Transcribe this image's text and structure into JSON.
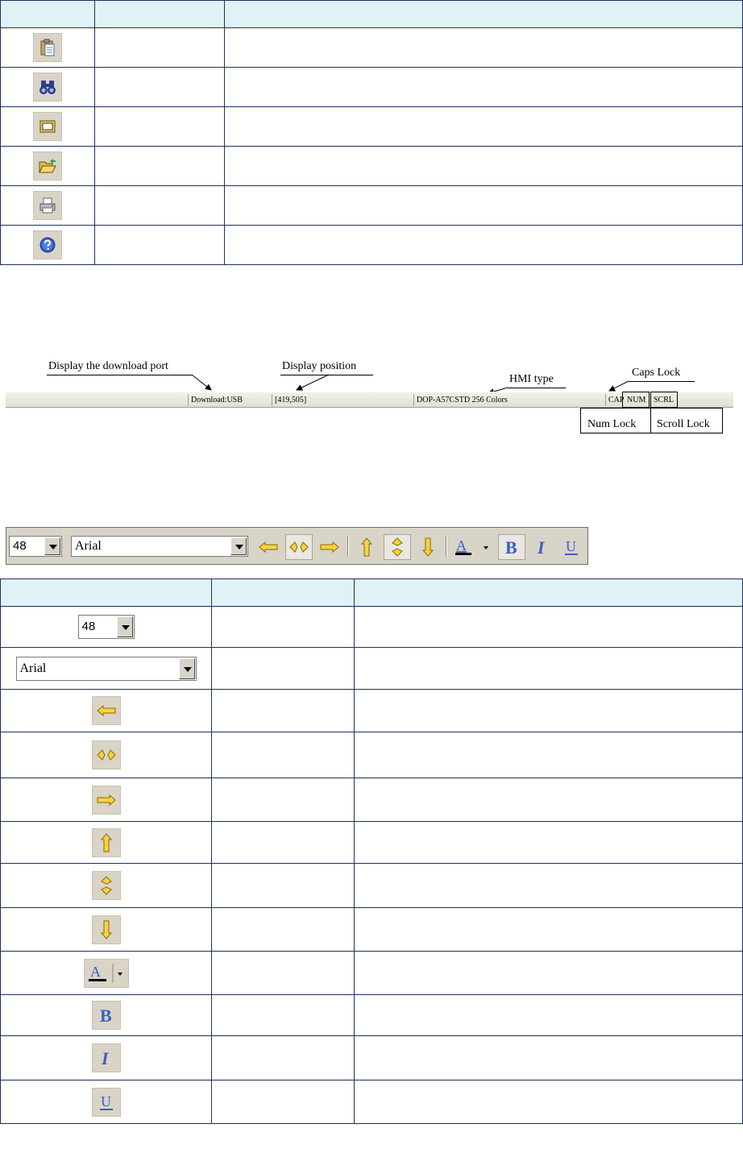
{
  "table1": {
    "rows": [
      {
        "icon": "paste-icon"
      },
      {
        "icon": "binoculars-find-icon"
      },
      {
        "icon": "screen-window-icon"
      },
      {
        "icon": "open-folder-icon"
      },
      {
        "icon": "printer-icon"
      },
      {
        "icon": "help-icon"
      }
    ]
  },
  "statusbar": {
    "download": "Download:USB",
    "position": "[419,505]",
    "hmi": "DOP-A57CSTD 256 Colors",
    "cap": "CAP",
    "num": "NUM",
    "scrl": "SCRL"
  },
  "annotations": {
    "download_port": "Display the download port",
    "display_position": "Display position",
    "hmi_type": "HMI type",
    "caps_lock": "Caps Lock",
    "num_lock": "Num Lock",
    "scroll_lock": "Scroll Lock"
  },
  "toolbar": {
    "font_size": "48",
    "font_name": "Arial",
    "icons": [
      "align-left-icon",
      "align-center-icon",
      "align-right-icon",
      "align-top-icon",
      "align-middle-icon",
      "align-bottom-icon",
      "font-color-icon",
      "bold-icon",
      "italic-icon",
      "underline-icon"
    ],
    "pressed": [
      "align-center-icon",
      "align-middle-icon",
      "bold-icon"
    ]
  },
  "table2": {
    "font_size": "48",
    "font_name": "Arial"
  },
  "colors": {
    "header_bg": "#dff3f7",
    "border": "#1f2f5c",
    "toolbar_bg": "#d8d4c8",
    "arrow_yellow": "#f6d33a",
    "text_blue": "#3a5fc4"
  }
}
